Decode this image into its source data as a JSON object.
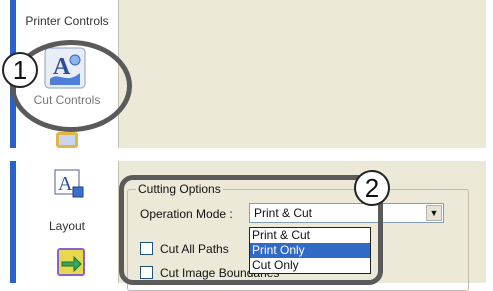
{
  "top_panel": {
    "sidebar_items": [
      {
        "icon": "printer-icon",
        "label": "Printer Controls"
      },
      {
        "icon": "cut-controls-icon",
        "label": "Cut Controls"
      },
      {
        "icon": "next-item-icon",
        "label": ""
      }
    ]
  },
  "bottom_panel": {
    "sidebar_items": [
      {
        "icon": "layout-icon",
        "label": "Layout"
      },
      {
        "icon": "arrow-tool-icon",
        "label": ""
      }
    ],
    "group_title": "Cutting Options",
    "operation_mode_label": "Operation Mode :",
    "operation_mode_value": "Print & Cut",
    "dropdown_options": [
      "Print & Cut",
      "Print Only",
      "Cut Only"
    ],
    "selected_option": "Print Only",
    "checkboxes": [
      {
        "label": "Cut All Paths",
        "checked": false
      },
      {
        "label": "Cut Image Boundaries",
        "checked": false
      }
    ]
  },
  "callouts": [
    "1",
    "2"
  ],
  "colors": {
    "window_bg": "#ece9d8",
    "accent_blue": "#2a62c9",
    "selection": "#316ac5",
    "callout": "#5a5a5a"
  }
}
